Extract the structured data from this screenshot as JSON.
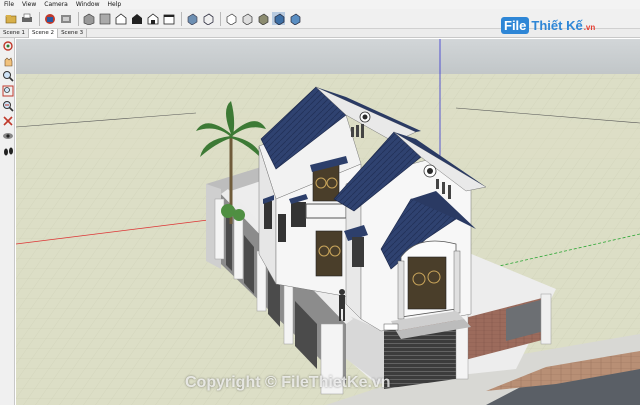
{
  "menu": {
    "items": [
      "File",
      "View",
      "Camera",
      "Window",
      "Help"
    ]
  },
  "toolbar": {
    "buttons": [
      "open-icon",
      "print-icon",
      "get-models-icon",
      "share-icon",
      "iso-view-icon",
      "top-view-icon",
      "front-view-icon",
      "right-view-icon",
      "back-view-icon",
      "left-view-icon",
      "xray-icon",
      "wireframe-icon",
      "hidden-line-icon",
      "shaded-icon",
      "shaded-textures-icon",
      "monochrome-icon"
    ]
  },
  "scene_tabs": [
    "Scene 1",
    "Scene 2",
    "Scene 3"
  ],
  "active_scene": "Scene 2",
  "left_tools": [
    "orbit-icon",
    "pan-icon",
    "zoom-icon",
    "zoom-window-icon",
    "zoom-extents-icon",
    "previous-icon",
    "walk-icon",
    "look-around-icon",
    "position-camera-icon"
  ],
  "watermark": {
    "logo_box": "File",
    "logo_text": "Thiết Kế",
    "logo_domain": ".vn",
    "copyright": "Copyright © FileThietKe.vn"
  },
  "colors": {
    "sky": "#c8cdcf",
    "ground": "#dfe0c8",
    "roof": "#2d3f6b",
    "wall": "#f1f1f1",
    "fence_brick": "#9c6b5c",
    "red_axis": "#d33",
    "green_axis": "#2aa532",
    "blue_axis": "#3333d0"
  }
}
